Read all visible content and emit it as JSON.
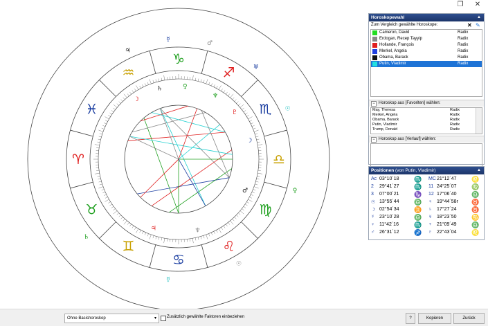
{
  "window": {
    "restore_glyph": "❐",
    "close_glyph": "✕"
  },
  "horoscope_panel": {
    "title": "Horoskopewahl",
    "compare_label": "Zum Vergleich gewählte Horoskope:",
    "delete_glyph": "✕",
    "edit_glyph": "✎",
    "items": [
      {
        "name": "Cameron, David",
        "type": "Radix",
        "color": "#22dd22",
        "selected": false
      },
      {
        "name": "Erdogan, Recep Tayyip",
        "type": "Radix",
        "color": "#888888",
        "selected": false
      },
      {
        "name": "Hollande, François",
        "type": "Radix",
        "color": "#e02020",
        "selected": false
      },
      {
        "name": "Merkel, Angela",
        "type": "Radix",
        "color": "#2040e0",
        "selected": false
      },
      {
        "name": "Obama, Barack",
        "type": "Radix",
        "color": "#111111",
        "selected": false
      },
      {
        "name": "Putin, Vladimir",
        "type": "Radix",
        "color": "#22e0e0",
        "selected": true
      }
    ],
    "favorites_header": "Horoskop aus [Favoriten] wählen:",
    "favorites": [
      {
        "name": "May, Theresa",
        "type": "Radix"
      },
      {
        "name": "Merkel, Angela",
        "type": "Radix"
      },
      {
        "name": "Obama, Barack",
        "type": "Radix"
      },
      {
        "name": "Putin, Vladimir",
        "type": "Radix"
      },
      {
        "name": "Trump, Donald",
        "type": "Radix"
      }
    ],
    "history_header": "Horoskop aus [Verlauf] wählen:"
  },
  "positions_panel": {
    "title": "Positionen",
    "subtitle": "(von Putin, Vladimir)",
    "left": [
      {
        "label": "Ac",
        "value": "03°10´18",
        "sign": "♏",
        "sign_color": "#1a3da0"
      },
      {
        "label": "2",
        "value": "29°41´27",
        "sign": "♏",
        "sign_color": "#1a3da0"
      },
      {
        "label": "3",
        "value": "07°00´21",
        "sign": "♑",
        "sign_color": "#20a020"
      },
      {
        "label": "☉",
        "value": "13°55´44",
        "sign": "♎",
        "sign_color": "#c8a000"
      },
      {
        "label": "☽",
        "value": "02°54´34",
        "sign": "♊",
        "sign_color": "#c8a000"
      },
      {
        "label": "☿",
        "value": "23°10´28",
        "sign": "♎",
        "sign_color": "#c8a000"
      },
      {
        "label": "♀",
        "value": "11°42´16",
        "sign": "♏",
        "sign_color": "#1a3da0"
      },
      {
        "label": "♂",
        "value": "26°31´12",
        "sign": "♐",
        "sign_color": "#e02020"
      }
    ],
    "right": [
      {
        "label": "MC",
        "value": "21°12´47",
        "sign": "♌",
        "sign_color": "#e02020"
      },
      {
        "label": "11",
        "value": "24°25´07",
        "sign": "♍",
        "sign_color": "#20a020"
      },
      {
        "label": "12",
        "value": "17°06´40",
        "sign": "♎",
        "sign_color": "#c8a000"
      },
      {
        "label": "♃",
        "value": "19°44´58r",
        "sign": "♉",
        "sign_color": "#20a020"
      },
      {
        "label": "♄",
        "value": "17°27´24",
        "sign": "♉",
        "sign_color": "#20a020"
      },
      {
        "label": "♅",
        "value": "18°23´50",
        "sign": "♋",
        "sign_color": "#1a3da0"
      },
      {
        "label": "♆",
        "value": "21°09´49",
        "sign": "♎",
        "sign_color": "#c8a000"
      },
      {
        "label": "♇",
        "value": "22°43´04",
        "sign": "♌",
        "sign_color": "#e02020"
      }
    ]
  },
  "chart": {
    "signs": [
      {
        "glyph": "♑",
        "color": "#20a020"
      },
      {
        "glyph": "♐",
        "color": "#e02020"
      },
      {
        "glyph": "♏",
        "color": "#1a3da0"
      },
      {
        "glyph": "♎",
        "color": "#c8a000"
      },
      {
        "glyph": "♍",
        "color": "#20a020"
      },
      {
        "glyph": "♌",
        "color": "#e02020"
      },
      {
        "glyph": "♋",
        "color": "#1a3da0"
      },
      {
        "glyph": "♊",
        "color": "#c8a000"
      },
      {
        "glyph": "♉",
        "color": "#20a020"
      },
      {
        "glyph": "♈",
        "color": "#e02020"
      },
      {
        "glyph": "♓",
        "color": "#1a3da0"
      },
      {
        "glyph": "♒",
        "color": "#c8a000"
      }
    ],
    "planet_marks": [
      {
        "g": "☽",
        "c": "#e02020"
      },
      {
        "g": "♃",
        "c": "#111111"
      },
      {
        "g": "♄",
        "c": "#111111"
      },
      {
        "g": "☿",
        "c": "#1a3da0"
      },
      {
        "g": "♀",
        "c": "#20a020"
      },
      {
        "g": "♂",
        "c": "#888888"
      },
      {
        "g": "♆",
        "c": "#20a020"
      },
      {
        "g": "♅",
        "c": "#1a3da0"
      },
      {
        "g": "♇",
        "c": "#e02020"
      },
      {
        "g": "☉",
        "c": "#20c0c0"
      },
      {
        "g": "☽",
        "c": "#1a3da0"
      },
      {
        "g": "♀",
        "c": "#20a020"
      },
      {
        "g": "♂",
        "c": "#111111"
      },
      {
        "g": "☉",
        "c": "#888888"
      },
      {
        "g": "♆",
        "c": "#888888"
      },
      {
        "g": "☿",
        "c": "#20c0c0"
      },
      {
        "g": "♃",
        "c": "#e02020"
      },
      {
        "g": "♄",
        "c": "#20a020"
      }
    ]
  },
  "bottom": {
    "base_select": "Ohne Basishoroskop",
    "checkbox_label": "Zusätzlich gewählte Faktoren einbeziehen",
    "help_label": "?",
    "copy_label": "Kopieren",
    "back_label": "Zurück"
  }
}
